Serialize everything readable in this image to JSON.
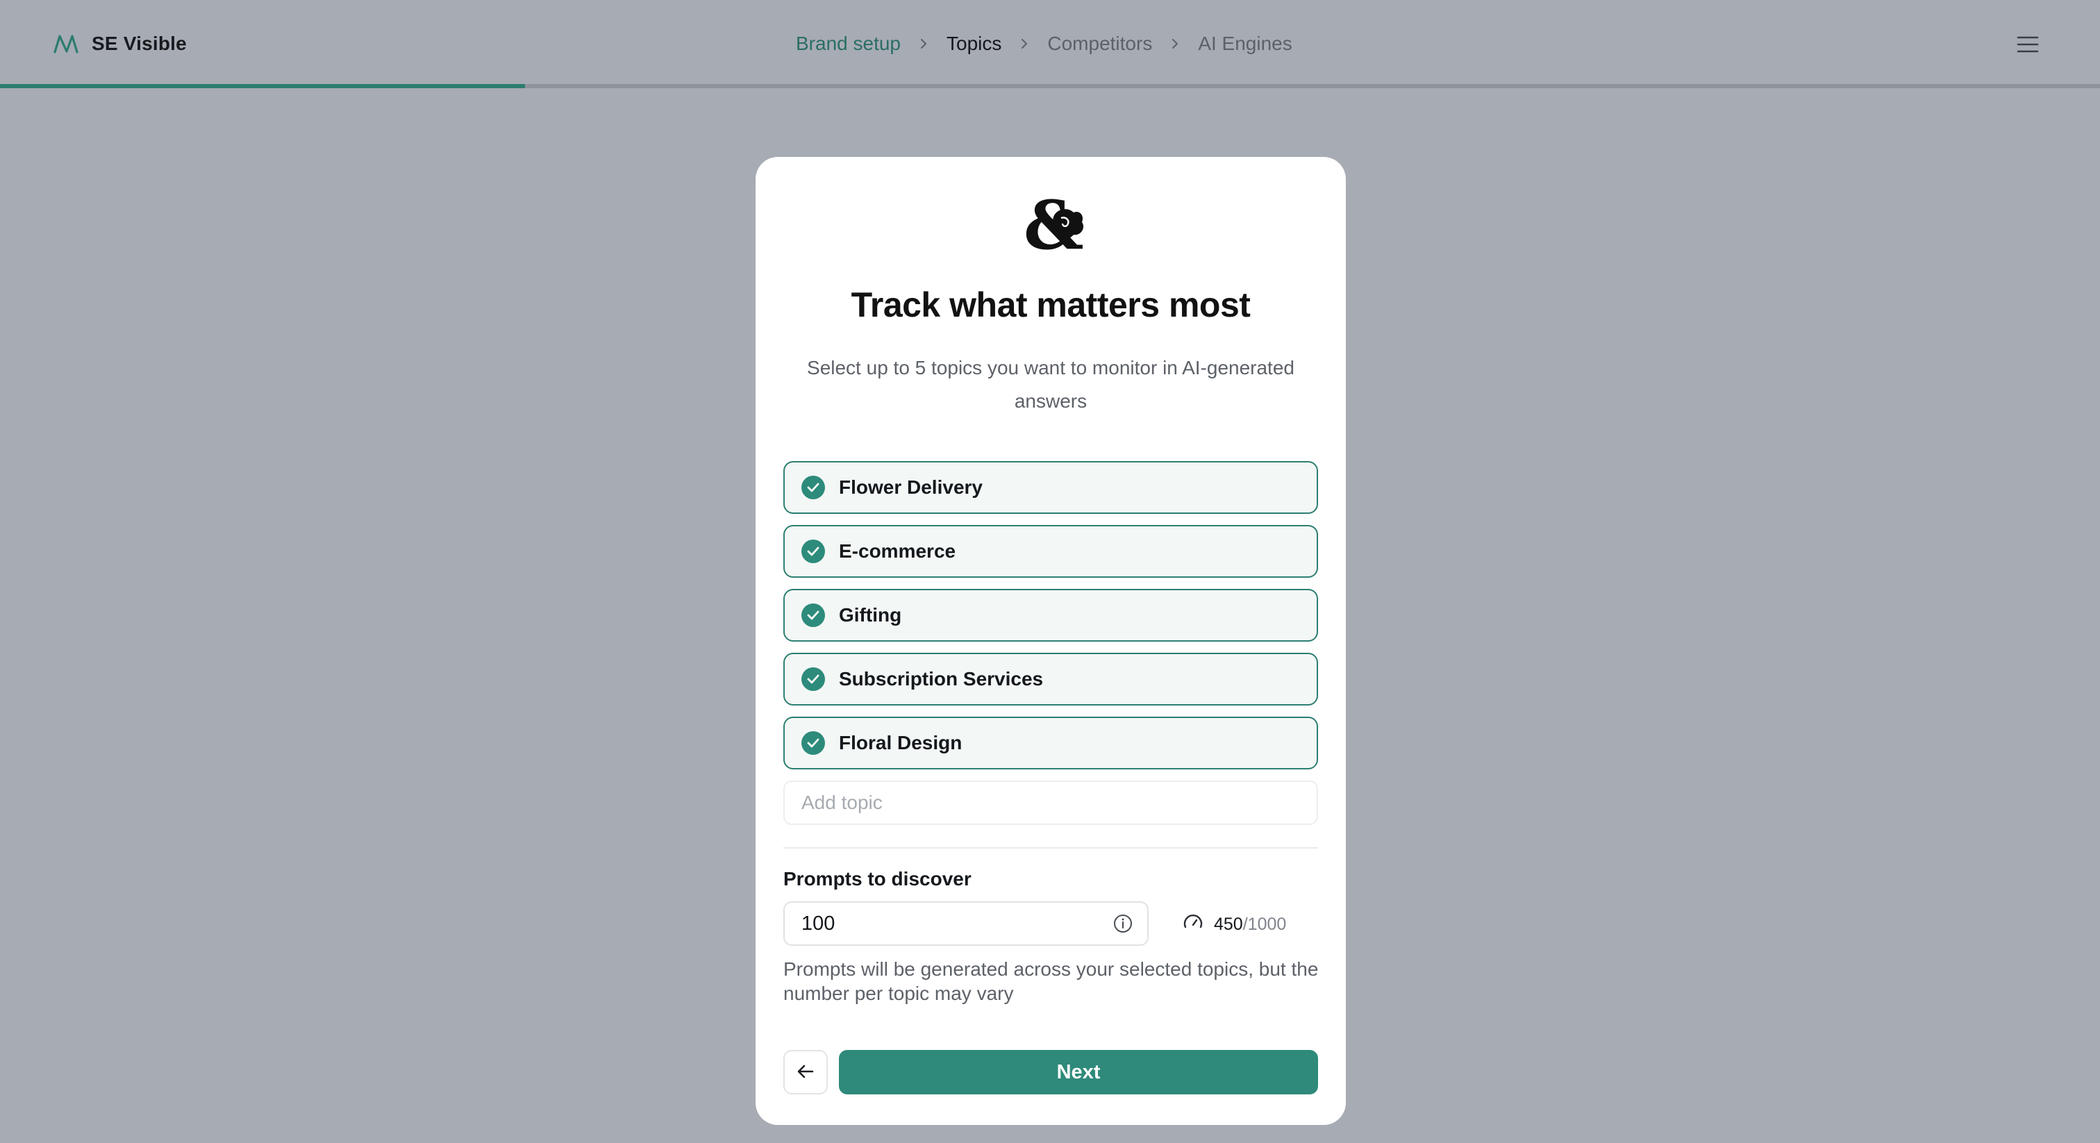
{
  "app": {
    "name": "SE Visible",
    "logo_icon": "wave-logo-icon",
    "accent_color": "#2f8a7b",
    "menu_icon": "hamburger-menu-icon"
  },
  "steps": [
    {
      "label": "Brand setup",
      "state": "done"
    },
    {
      "label": "Topics",
      "state": "active"
    },
    {
      "label": "Competitors",
      "state": "upcoming"
    },
    {
      "label": "AI Engines",
      "state": "upcoming"
    }
  ],
  "progress": {
    "fraction": 0.25
  },
  "card": {
    "logo_icon": "ampersand-rose-logo-icon",
    "title": "Track what matters most",
    "subtitle": "Select up to 5 topics you want to monitor in AI-generated answers",
    "topics": [
      {
        "label": "Flower Delivery",
        "checked": true
      },
      {
        "label": "E-commerce",
        "checked": true
      },
      {
        "label": "Gifting",
        "checked": true
      },
      {
        "label": "Subscription Services",
        "checked": true
      },
      {
        "label": "Floral Design",
        "checked": true
      }
    ],
    "add_topic_placeholder": "Add topic",
    "prompts": {
      "label": "Prompts to discover",
      "value": "100",
      "info_icon": "info-icon",
      "usage_icon": "gauge-icon",
      "used": "450",
      "total": "/1000",
      "helper": "Prompts will be generated across your selected topics, but the number per topic may vary"
    },
    "back_icon": "arrow-left-icon",
    "next_label": "Next"
  }
}
